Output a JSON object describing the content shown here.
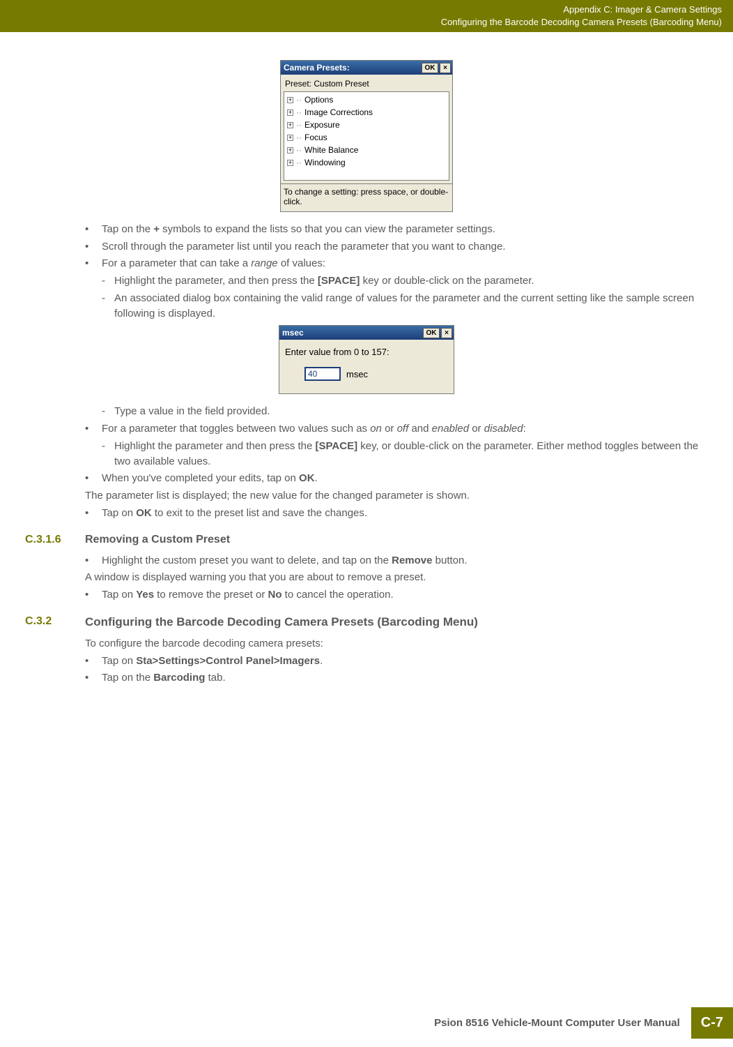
{
  "header": {
    "line1": "Appendix C: Imager & Camera Settings",
    "line2": "Configuring the Barcode Decoding Camera Presets (Barcoding Menu)"
  },
  "dialog1": {
    "title": "Camera Presets:",
    "ok": "OK",
    "close": "×",
    "preset_label": "Preset: Custom Preset",
    "tree": [
      "Options",
      "Image Corrections",
      "Exposure",
      "Focus",
      "White Balance",
      "Windowing"
    ],
    "hint": "To change a setting: press space, or double-click."
  },
  "bullets1": [
    {
      "pre": "Tap on the ",
      "bold": "+",
      "post": " symbols to expand the lists so that you can view the parameter settings."
    },
    {
      "pre": "Scroll through the parameter list until you reach the parameter that you want to change.",
      "bold": "",
      "post": ""
    },
    {
      "pre": "For a parameter that can take a ",
      "ital": "range",
      "post": " of values:"
    }
  ],
  "subs1": [
    {
      "pre": "Highlight the parameter, and then press the ",
      "bold": "[SPACE]",
      "post": " key or double-click on the parameter."
    },
    {
      "pre": "An associated dialog box containing the valid range of values for the parameter and the current setting like the sample screen following is displayed.",
      "bold": "",
      "post": ""
    }
  ],
  "dialog2": {
    "title": "msec",
    "ok": "OK",
    "close": "×",
    "prompt": "Enter value from 0 to 157:",
    "value": "40",
    "unit": "msec"
  },
  "subs2": [
    {
      "pre": "Type a value in the field provided.",
      "bold": "",
      "post": ""
    }
  ],
  "bullets2": [
    {
      "pre": "For a parameter that toggles between two values such as ",
      "ital": "on",
      "mid": " or ",
      "ital2": "off",
      "mid2": " and ",
      "ital3": "enabled",
      "mid3": " or ",
      "ital4": "disabled",
      "post": ":"
    }
  ],
  "subs3": [
    {
      "pre": "Highlight the parameter and then press the ",
      "bold": "[SPACE]",
      "post": " key, or double-click on the parameter. Either method toggles between the two available values."
    }
  ],
  "bullets3": [
    {
      "pre": "When you've completed your edits, tap on ",
      "bold": "OK",
      "post": "."
    }
  ],
  "para1": "The parameter list is displayed; the new value for the changed parameter is shown.",
  "bullets4": [
    {
      "pre": "Tap on ",
      "bold": "OK",
      "post": " to exit to the preset list and save the changes."
    }
  ],
  "sec1": {
    "num": "C.3.1.6",
    "title": "Removing a Custom Preset"
  },
  "bullets5": [
    {
      "pre": "Highlight the custom preset you want to delete, and tap on the ",
      "bold": "Remove",
      "post": " button."
    }
  ],
  "para2": "A window is displayed warning you that you are about to remove a preset.",
  "bullets6": [
    {
      "pre": "Tap on ",
      "bold": "Yes",
      "post": " to remove the preset or ",
      "bold2": "No",
      "post2": " to cancel the operation."
    }
  ],
  "sec2": {
    "num": "C.3.2",
    "title": "Configuring the Barcode Decoding Camera Presets (Barcoding Menu)"
  },
  "para3": "To configure the barcode decoding camera presets:",
  "bullets7": [
    {
      "pre": "Tap on ",
      "bold": "Sta>Settings>Control Panel>Imagers",
      "post": "."
    },
    {
      "pre": "Tap on the ",
      "bold": "Barcoding",
      "post": " tab."
    }
  ],
  "footer": {
    "text": "Psion 8516 Vehicle-Mount Computer User Manual",
    "page": "C-7"
  }
}
